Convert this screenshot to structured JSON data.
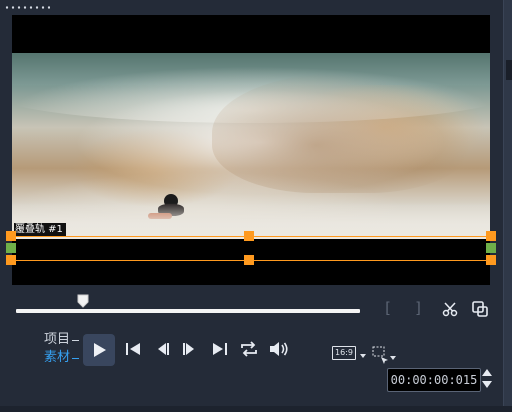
{
  "overlay": {
    "track_label": "覆叠轨 #1"
  },
  "mode": {
    "project_label": "项目",
    "clip_label": "素材",
    "active": "clip"
  },
  "playback": {
    "progress": 0.196
  },
  "aspect_ratio": {
    "label": "16:9"
  },
  "timecode": {
    "value": "00:00:00:015"
  },
  "icons": {
    "play": "play-icon",
    "home": "go-to-start-icon",
    "prev_frame": "previous-frame-icon",
    "next_frame": "next-frame-icon",
    "end": "go-to-end-icon",
    "repeat": "repeat-icon",
    "volume": "volume-icon",
    "mark_in": "mark-in-icon",
    "mark_out": "mark-out-icon",
    "split": "scissors-icon",
    "copy": "copy-icon",
    "select": "select-region-icon"
  },
  "colors": {
    "background": "#242b38",
    "accent_orange": "#ff9a1f",
    "accent_blue": "#36a0f0",
    "play_button": "#39465e"
  }
}
